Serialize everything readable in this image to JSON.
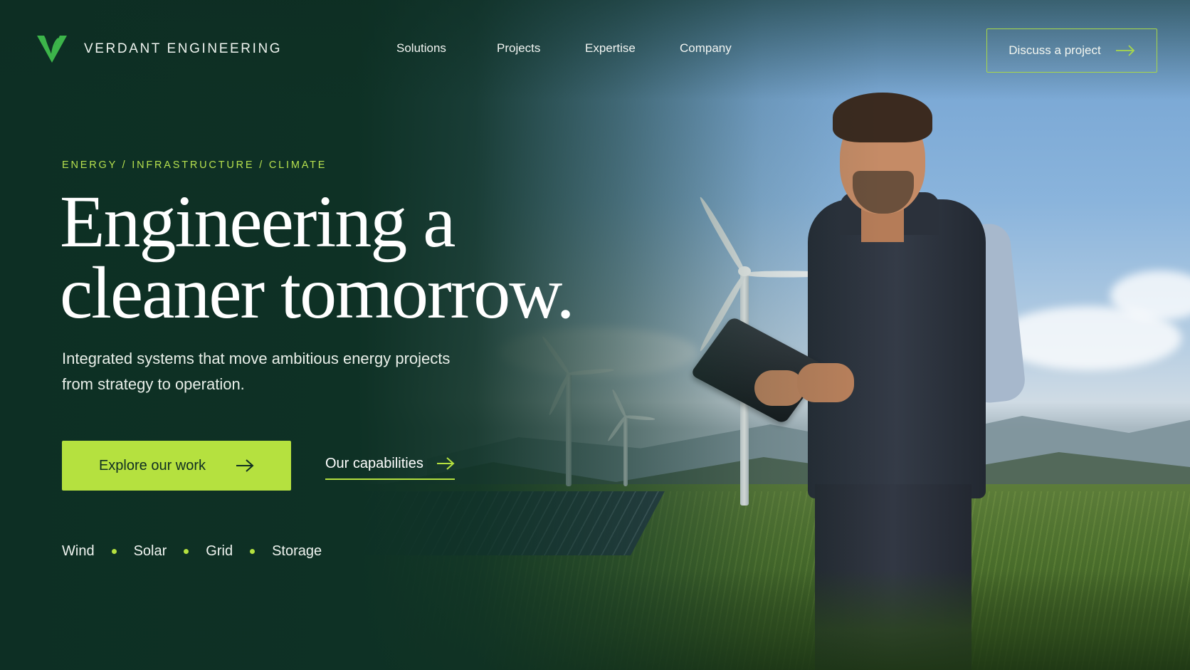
{
  "brand": {
    "name": "VERDANT ENGINEERING",
    "logo_icon": "leaf-v-logo-icon",
    "accent_color": "#b5e13f",
    "logo_color": "#3cb54a"
  },
  "nav": {
    "items": [
      {
        "label": "Solutions"
      },
      {
        "label": "Projects"
      },
      {
        "label": "Expertise"
      },
      {
        "label": "Company"
      }
    ]
  },
  "header_cta": {
    "label": "Discuss a project",
    "icon": "arrow-right-icon"
  },
  "hero": {
    "eyebrow": "ENERGY / INFRASTRUCTURE / CLIMATE",
    "headline_line1": "Engineering a",
    "headline_line2": "cleaner tomorrow.",
    "subcopy": "Integrated systems that move ambitious energy projects from strategy to operation.",
    "primary_cta": {
      "label": "Explore our work",
      "icon": "arrow-right-icon"
    },
    "secondary_cta": {
      "label": "Our capabilities",
      "icon": "arrow-right-icon"
    },
    "tags": [
      "Wind",
      "Solar",
      "Grid",
      "Storage"
    ]
  },
  "colors": {
    "background_dark": "#0e3125",
    "accent": "#b5e13f",
    "text": "#ffffff"
  }
}
